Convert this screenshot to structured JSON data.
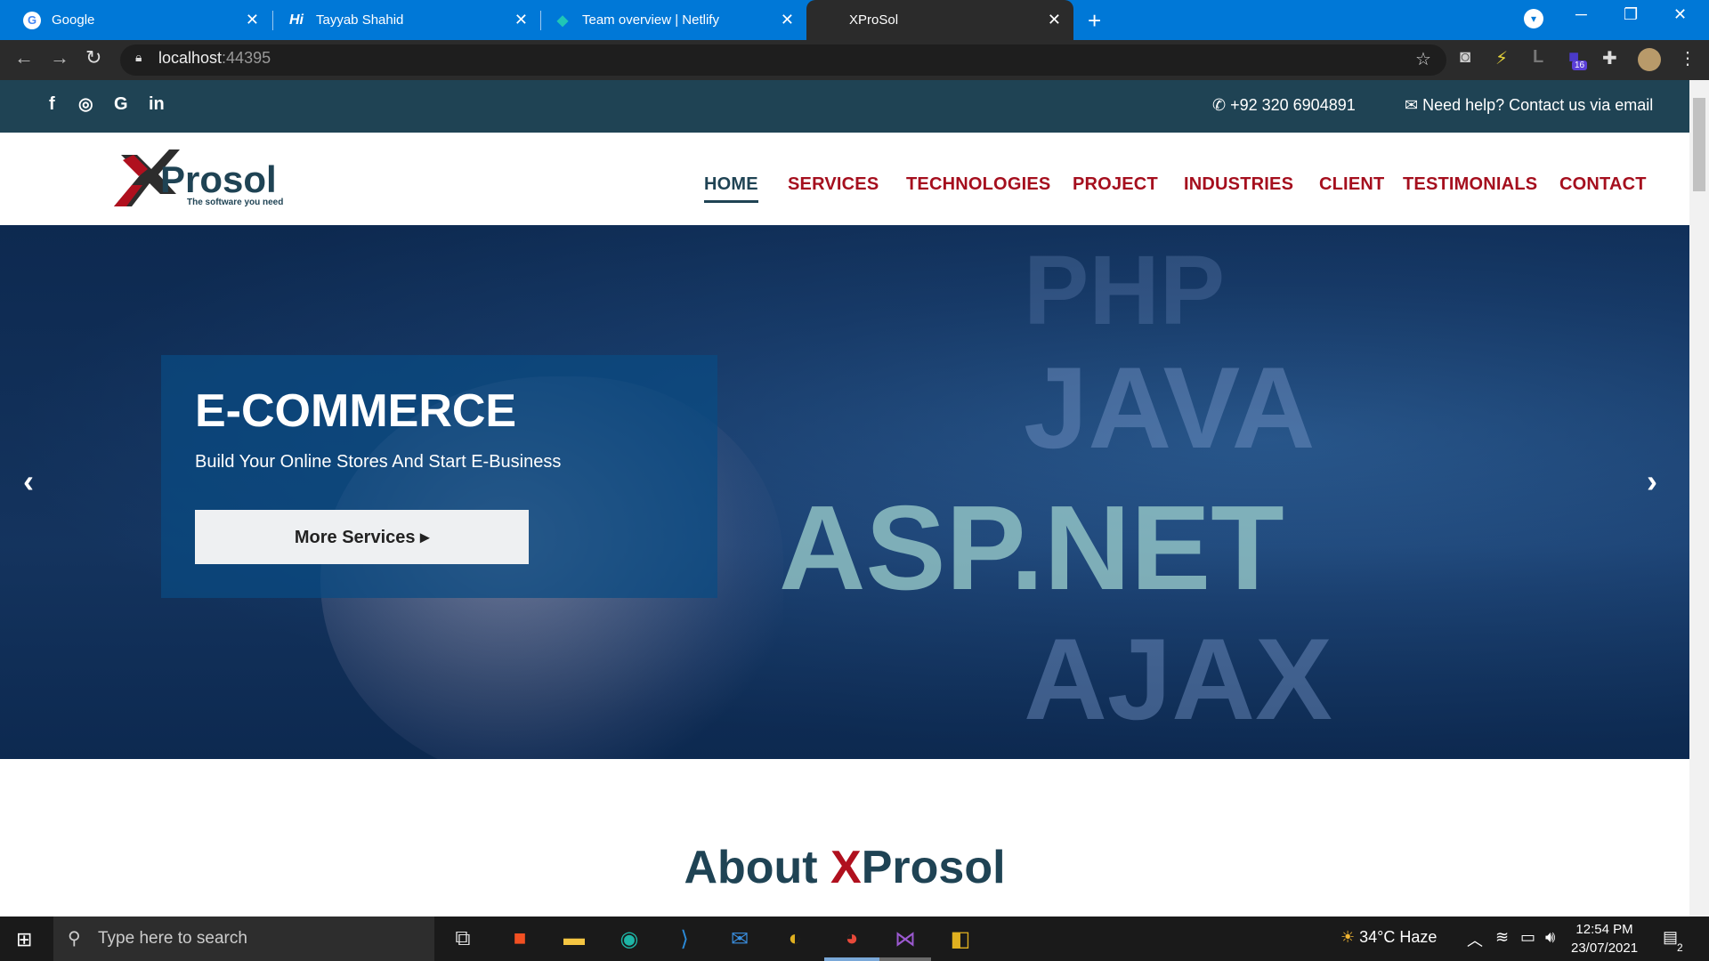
{
  "browser": {
    "tabs": [
      {
        "title": "Google",
        "icon": "G"
      },
      {
        "title": "Tayyab Shahid",
        "icon": "Hi"
      },
      {
        "title": "Team overview | Netlify",
        "icon": "◆"
      },
      {
        "title": "XProSol",
        "icon": ""
      }
    ],
    "url_host": "localhost",
    "url_port": ":44395",
    "extension_badge": "16"
  },
  "site": {
    "phone": "+92 320 6904891",
    "email_text": "Need help? Contact us via email",
    "logo_text": "Prosol",
    "logo_x": "X",
    "logo_tagline": "The software you need",
    "nav": [
      "HOME",
      "SERVICES",
      "TECHNOLOGIES",
      "PROJECT",
      "INDUSTRIES",
      "CLIENT",
      "TESTIMONIALS",
      "CONTACT"
    ],
    "hero": {
      "title": "E-COMMERCE",
      "subtitle": "Build Your Online Stores And Start E-Business",
      "button": "More Services ▸",
      "bg_words": [
        "PHP",
        "JAVA",
        "ASP.NET",
        "AJAX"
      ]
    },
    "about_prefix": "About ",
    "about_x": "X",
    "about_suffix": "Prosol"
  },
  "taskbar": {
    "search_placeholder": "Type here to search",
    "weather": "34°C  Haze",
    "time": "12:54 PM",
    "date": "23/07/2021",
    "notifications": "2"
  },
  "colors": {
    "topbar": "#1f4354",
    "nav_red": "#a50f1e",
    "chrome_blue": "#0078d7"
  }
}
